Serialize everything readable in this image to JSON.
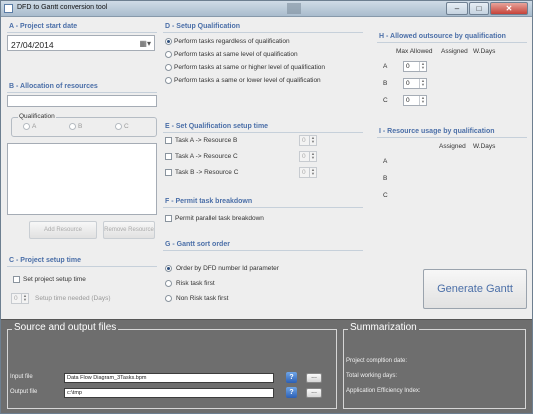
{
  "window": {
    "title": "DFD to Gantt conversion tool"
  },
  "sectionA": {
    "header": "A - Project start date",
    "date_value": "27/04/2014"
  },
  "sectionB": {
    "header": "B - Allocation of resources",
    "resource_input_value": "",
    "qualification_group_label": "Qualification",
    "qual_options": [
      "A",
      "B",
      "C"
    ],
    "add_button": "Add Resource",
    "remove_button": "Remove Resource"
  },
  "sectionC": {
    "header": "C - Project setup time",
    "checkbox_label": "Set project setup time",
    "setup_time_value": "0",
    "setup_time_label": "Setup time needed (Days)"
  },
  "sectionD": {
    "header": "D - Setup Qualification",
    "options": [
      "Perform tasks regardless of qualification",
      "Perform tasks at same level of qualification",
      "Perform tasks at same or higher level of qualification",
      "Perform tasks a same or lower level of qualification"
    ],
    "selected_index": 0
  },
  "sectionE": {
    "header": "E - Set Qualification setup time",
    "rows": [
      {
        "label": "Task A -> Resource B",
        "value": "0"
      },
      {
        "label": "Task A -> Resource C",
        "value": "0"
      },
      {
        "label": "Task B -> Resource C",
        "value": "0"
      }
    ]
  },
  "sectionF": {
    "header": "F - Permit task breakdown",
    "checkbox_label": "Permit parallel task breakdown"
  },
  "sectionG": {
    "header": "G - Gantt sort order",
    "options": [
      "Order by DFD number Id parameter",
      "Risk task first",
      "Non Risk task first"
    ],
    "selected_index": 0
  },
  "sectionH": {
    "header": "H - Allowed outsource by qualification",
    "columns": [
      "Max Allowed",
      "Assigned",
      "W.Days"
    ],
    "rows": [
      {
        "label": "A",
        "value": "0"
      },
      {
        "label": "B",
        "value": "0"
      },
      {
        "label": "C",
        "value": "0"
      }
    ]
  },
  "sectionI": {
    "header": "I - Resource usage by qualification",
    "columns": [
      "Assigned",
      "W.Days"
    ],
    "rows": [
      "A",
      "B",
      "C"
    ]
  },
  "generate_button": "Generate Gantt",
  "files": {
    "title": "Source and output files",
    "input_label": "Input file",
    "input_value": "Data Flow Diagram_3Tasks.bpm",
    "output_label": "Output file",
    "output_value": "c:\\tmp",
    "help_glyph": "?",
    "browse_glyph": "..."
  },
  "summary": {
    "title": "Summarization",
    "lines": [
      "Project compltion date:",
      "Total working days:",
      "Application Efficiency Index:"
    ]
  }
}
